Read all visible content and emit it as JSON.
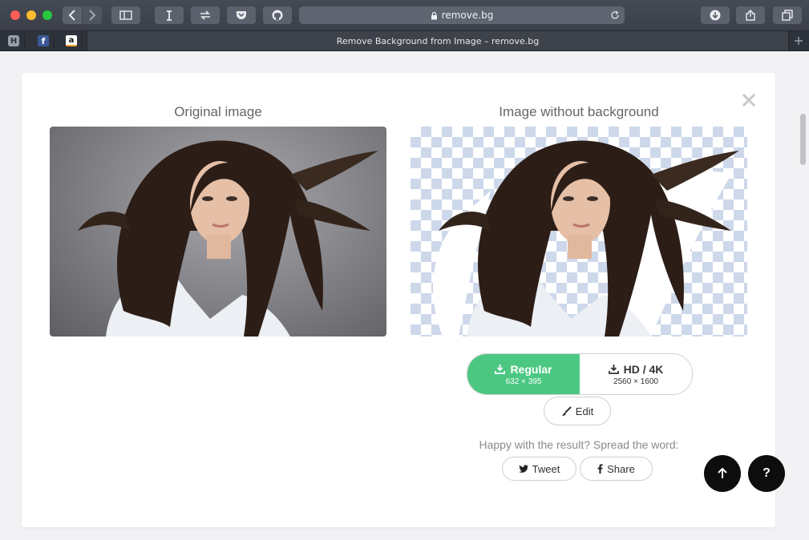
{
  "browser": {
    "address": "remove.bg",
    "tab_title": "Remove Background from Image – remove.bg",
    "favicons": [
      "H",
      "f",
      "a"
    ]
  },
  "page": {
    "original_heading": "Original image",
    "result_heading": "Image without background",
    "download": {
      "regular_label": "Regular",
      "regular_size": "632 × 395",
      "hd_label": "HD / 4K",
      "hd_size": "2560 × 1600"
    },
    "edit_label": "Edit",
    "share_prompt": "Happy with the result? Spread the word:",
    "tweet_label": "Tweet",
    "share_label": "Share",
    "help_label": "?"
  },
  "colors": {
    "accent_green": "#4cc782",
    "checker_blue": "#cdd8ea",
    "chrome_dark": "#3a3f48"
  }
}
